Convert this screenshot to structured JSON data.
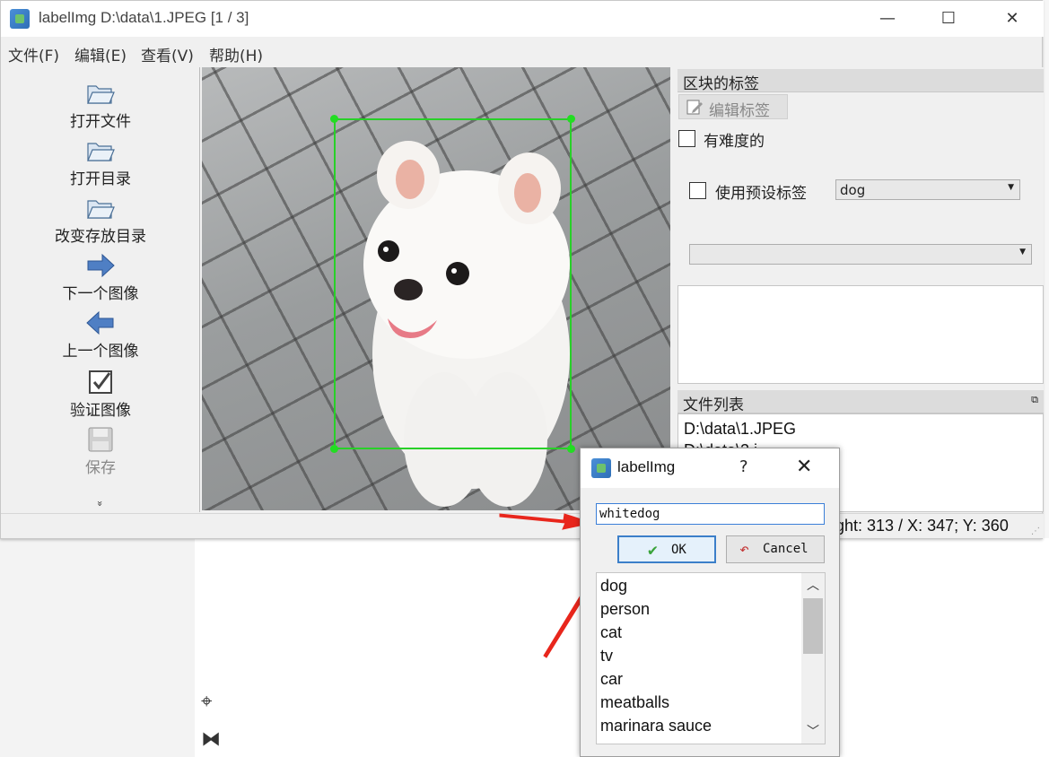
{
  "window": {
    "title": "labelImg D:\\data\\1.JPEG [1 / 3]",
    "minimize": "—",
    "maximize": "☐",
    "close": "✕"
  },
  "menu": [
    "文件(F)",
    "编辑(E)",
    "查看(V)",
    "帮助(H)"
  ],
  "toolbar": {
    "open_file": "打开文件",
    "open_dir": "打开目录",
    "change_save_dir": "改变存放目录",
    "next_image": "下一个图像",
    "prev_image": "上一个图像",
    "verify_image": "验证图像",
    "save": "保存",
    "more": "»"
  },
  "dock": {
    "box_labels_title": "区块的标签",
    "edit_label_button": "编辑标签",
    "difficult_label": "有难度的",
    "use_default_label": "使用预设标签",
    "default_label_value": "dog",
    "second_combo_value": "",
    "file_list_title": "文件列表",
    "files": [
      "D:\\data\\1.JPEG",
      "D:\\data\\2.j..."
    ]
  },
  "status": {
    "text": "ght: 313 / X: 347; Y: 360"
  },
  "dialog": {
    "title": "labelImg",
    "help": "?",
    "close": "✕",
    "input_value": "whitedog",
    "ok_label": "OK",
    "cancel_label": "Cancel",
    "labels": [
      "dog",
      "person",
      "cat",
      "tv",
      "car",
      "meatballs",
      "marinara sauce"
    ]
  },
  "annotation_box_color": "#28d028",
  "arrow_color": "#e8261c"
}
